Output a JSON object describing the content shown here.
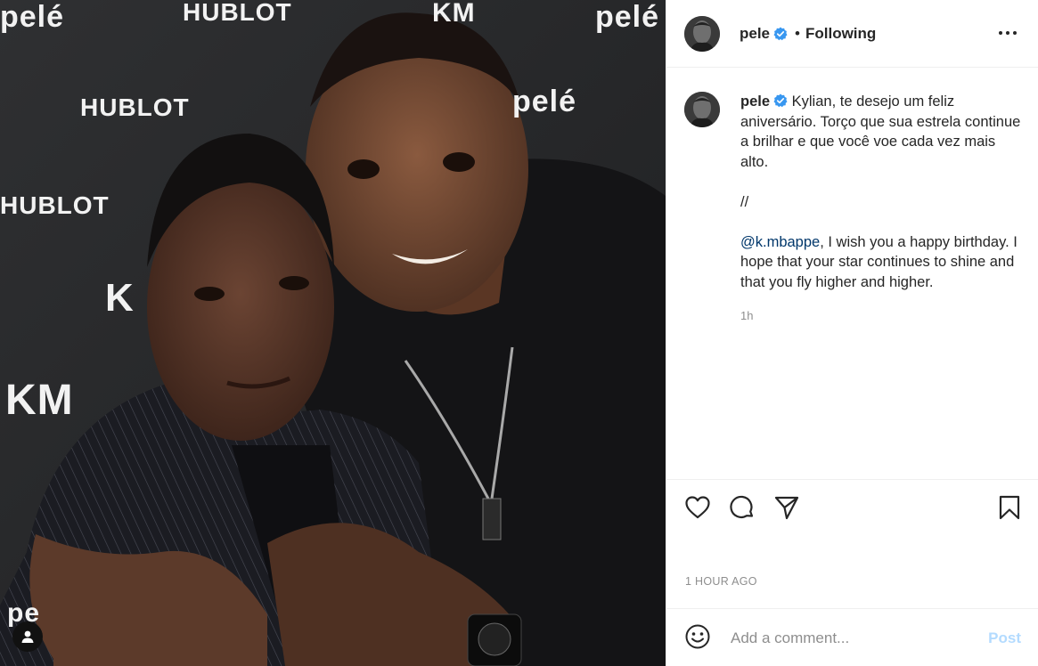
{
  "photo": {
    "wall_text": [
      "pelé",
      "HUBLOT",
      "KM",
      "pelé",
      "HUBLOT",
      "pelé",
      "HUBLOT",
      "K",
      "KM",
      "pe"
    ],
    "tag_icon": "user-tag-icon"
  },
  "header": {
    "username": "pele",
    "verified_icon": "verified-badge-icon",
    "separator": "•",
    "follow_status": "Following",
    "more_icon": "more-options-icon"
  },
  "caption": {
    "username": "pele",
    "text_pt": "Kylian, te desejo um feliz aniversário. Torço que sua estrela continue a brilhar e que você voe cada vez mais alto.",
    "divider": "//",
    "mention": "@k.mbappe",
    "text_en": ", I wish you a happy birthday. I hope that your star continues to shine and that you fly higher and higher.",
    "time": "1h"
  },
  "actions": {
    "like_icon": "heart-icon",
    "comment_icon": "comment-icon",
    "share_icon": "send-icon",
    "save_icon": "bookmark-icon"
  },
  "timestamp": "1 HOUR AGO",
  "comment_box": {
    "emoji_icon": "emoji-icon",
    "placeholder": "Add a comment...",
    "post_label": "Post"
  },
  "colors": {
    "verified": "#3897f0",
    "post_disabled": "#b3dbff",
    "mention": "#00376b",
    "secondary_text": "#8e8e8e"
  }
}
